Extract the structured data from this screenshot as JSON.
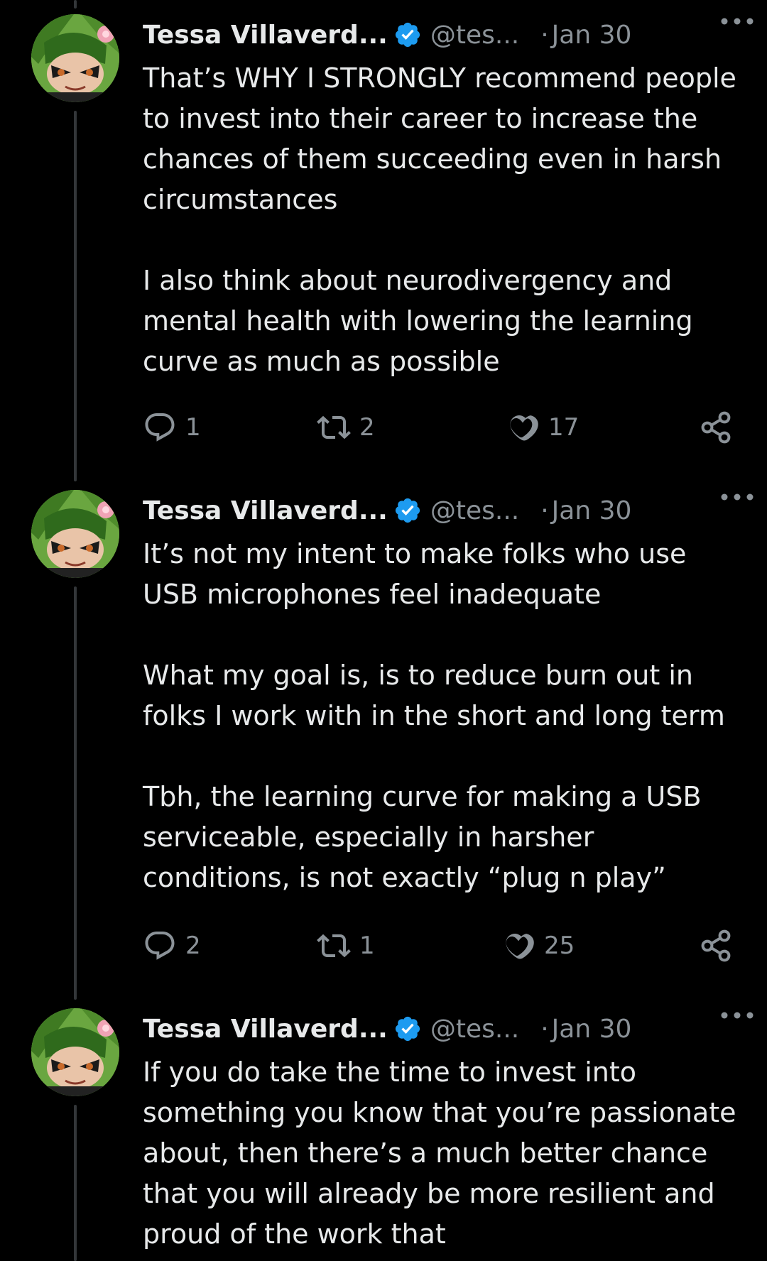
{
  "colors": {
    "background": "#000000",
    "text_primary": "#e7e9ea",
    "text_secondary": "#8b9298",
    "verified_badge": "#1d9bf0",
    "thread_line": "#333639"
  },
  "tweets": [
    {
      "author_name": "Tessa Villaverd...",
      "verified": true,
      "handle": "@tes...",
      "separator": "·",
      "date": "Jan 30",
      "paragraphs": [
        "That’s WHY I STRONGLY recommend people to invest into their career to increase the chances of them succeeding even in harsh circumstances",
        "I also think about neurodivergency and mental health with lowering the learning curve as much as possible"
      ],
      "reply_count": "1",
      "retweet_count": "2",
      "like_count": "17"
    },
    {
      "author_name": "Tessa Villaverd...",
      "verified": true,
      "handle": "@tes...",
      "separator": "·",
      "date": "Jan 30",
      "paragraphs": [
        "It’s not my intent to make folks who use USB microphones feel inadequate",
        "What my goal is, is to reduce burn out in folks I work with in the short and long term",
        "Tbh, the learning curve for making a USB serviceable, especially in harsher conditions, is not exactly “plug n play”"
      ],
      "reply_count": "2",
      "retweet_count": "1",
      "like_count": "25"
    },
    {
      "author_name": "Tessa Villaverd...",
      "verified": true,
      "handle": "@tes...",
      "separator": "·",
      "date": "Jan 30",
      "paragraphs": [
        "If you do take the time to invest into something you know that you’re passionate about, then there’s a much better chance that you will already be more resilient and proud of the work that"
      ]
    }
  ],
  "icons": {
    "avatar": "avatar-icon",
    "verified": "verified-badge-icon",
    "more": "more-options-icon",
    "reply": "reply-icon",
    "retweet": "retweet-icon",
    "like": "heart-icon",
    "share": "share-icon"
  }
}
